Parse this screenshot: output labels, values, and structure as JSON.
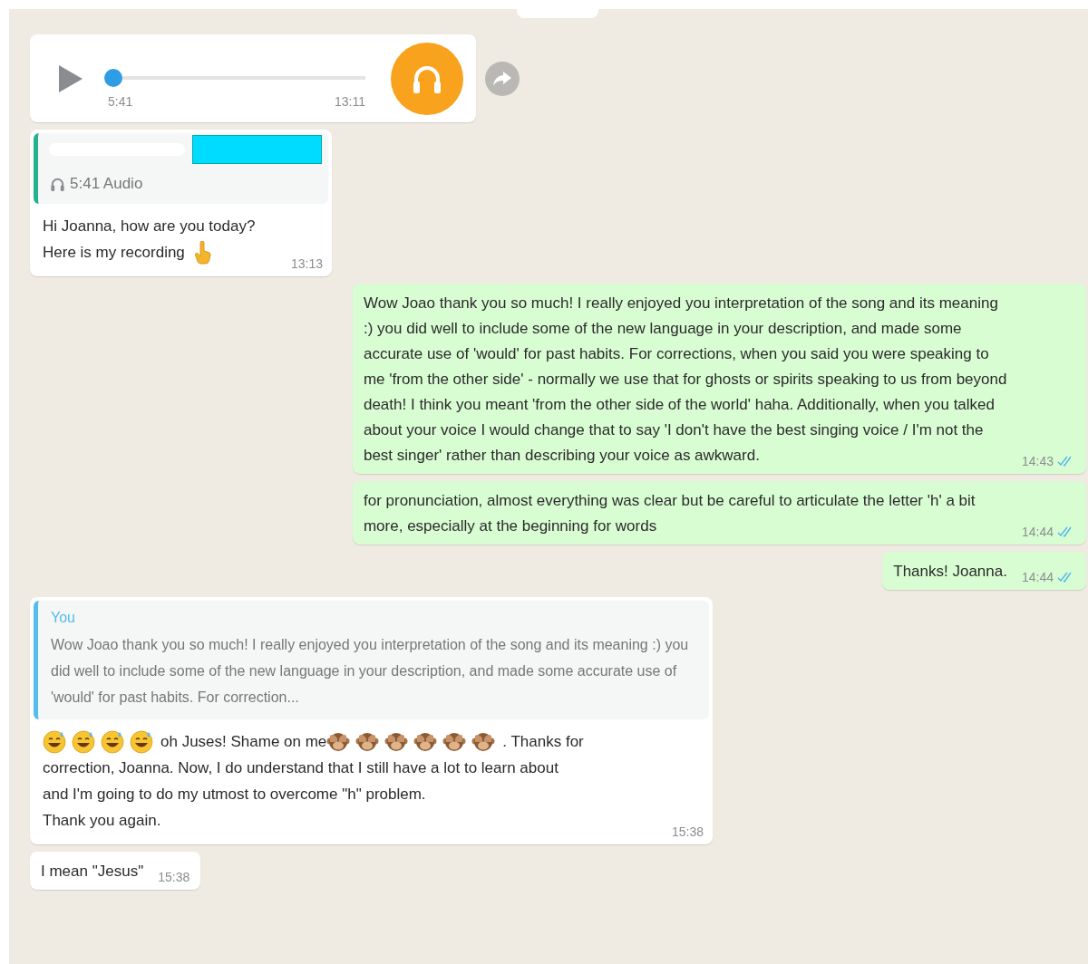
{
  "messages": [
    {
      "kind": "audio",
      "outgoing": false,
      "level": 0.0,
      "duration": "5:41",
      "time": "13:11"
    },
    {
      "kind": "reply",
      "outgoing": false,
      "quote": {
        "kind": "audio",
        "label": "5:41 Audio",
        "redacted": true
      },
      "lines": [
        "Hi Joanna, how are you today?",
        "Here is my recording"
      ],
      "pointer_emoji": true,
      "time": "13:13"
    },
    {
      "kind": "text",
      "outgoing": true,
      "text": "Wow Joao thank you so much! I really enjoyed you interpretation of the song and its meaning :) you did well to include some of the new language in your description, and made some accurate use of 'would' for past habits. For corrections, when you said you were speaking to me 'from the other side' - normally we use that for ghosts or spirits speaking to us from beyond death! I think you meant 'from the other side of the world' haha.  Additionally, when you talked about your voice I would change that to say 'I don't have the best singing voice / I'm not the best singer' rather than describing your voice as awkward.",
      "time": "14:43",
      "read": true
    },
    {
      "kind": "text",
      "outgoing": true,
      "text": "for pronunciation, almost everything was clear but be careful to articulate the letter 'h' a bit more, especially at the beginning for words",
      "time": "14:44",
      "read": true
    },
    {
      "kind": "text",
      "outgoing": true,
      "text": "Thanks! Joanna.",
      "time": "14:44",
      "read": true
    },
    {
      "kind": "reply",
      "outgoing": false,
      "quote": {
        "kind": "text",
        "author": "You",
        "text": "Wow Joao thank you so much! I really enjoyed you interpretation of the song and its meaning :) you did well to include some of the new language in your description, and made some accurate use of 'would' for past habits. For correction..."
      },
      "rows": [
        [
          {
            "kind": "sweat-smile"
          },
          {
            "kind": "sweat-smile"
          },
          {
            "kind": "sweat-smile"
          },
          {
            "kind": "sweat-smile"
          },
          {
            "kind": "text",
            "text": "oh Juses! Shame on me"
          },
          {
            "kind": "monkey"
          },
          {
            "kind": "monkey"
          },
          {
            "kind": "monkey"
          },
          {
            "kind": "monkey"
          },
          {
            "kind": "monkey"
          },
          {
            "kind": "monkey"
          },
          {
            "kind": "text",
            "text": ". Thanks for"
          }
        ],
        [
          {
            "kind": "text",
            "text": "correction, Joanna. Now, I do understand that I still have a lot to learn about"
          }
        ],
        [
          {
            "kind": "text",
            "text": "and I'm going to do my utmost to overcome \"h\" problem."
          }
        ],
        [
          {
            "kind": "text",
            "text": "Thank you again."
          }
        ]
      ],
      "time": "15:38"
    },
    {
      "kind": "text",
      "outgoing": false,
      "text": "I mean \"Jesus\"",
      "time": "15:38"
    }
  ]
}
